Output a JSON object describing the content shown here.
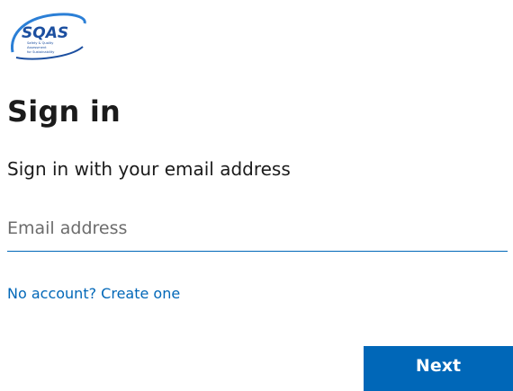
{
  "logo": {
    "wordmark": "SQAS",
    "tagline_lines": [
      "Safety & Quality",
      "Assessment",
      "for Sustainability"
    ],
    "colors": {
      "primary": "#1c4fa0",
      "accent": "#2b7fd6"
    }
  },
  "header": {
    "title": "Sign in",
    "subtitle": "Sign in with your email address"
  },
  "form": {
    "email_value": "",
    "email_placeholder": "Email address"
  },
  "links": {
    "create_account": "No account? Create one"
  },
  "buttons": {
    "next_label": "Next"
  },
  "colors": {
    "accent": "#0067b8",
    "text": "#1b1b1b",
    "placeholder": "#6c6c6c"
  }
}
